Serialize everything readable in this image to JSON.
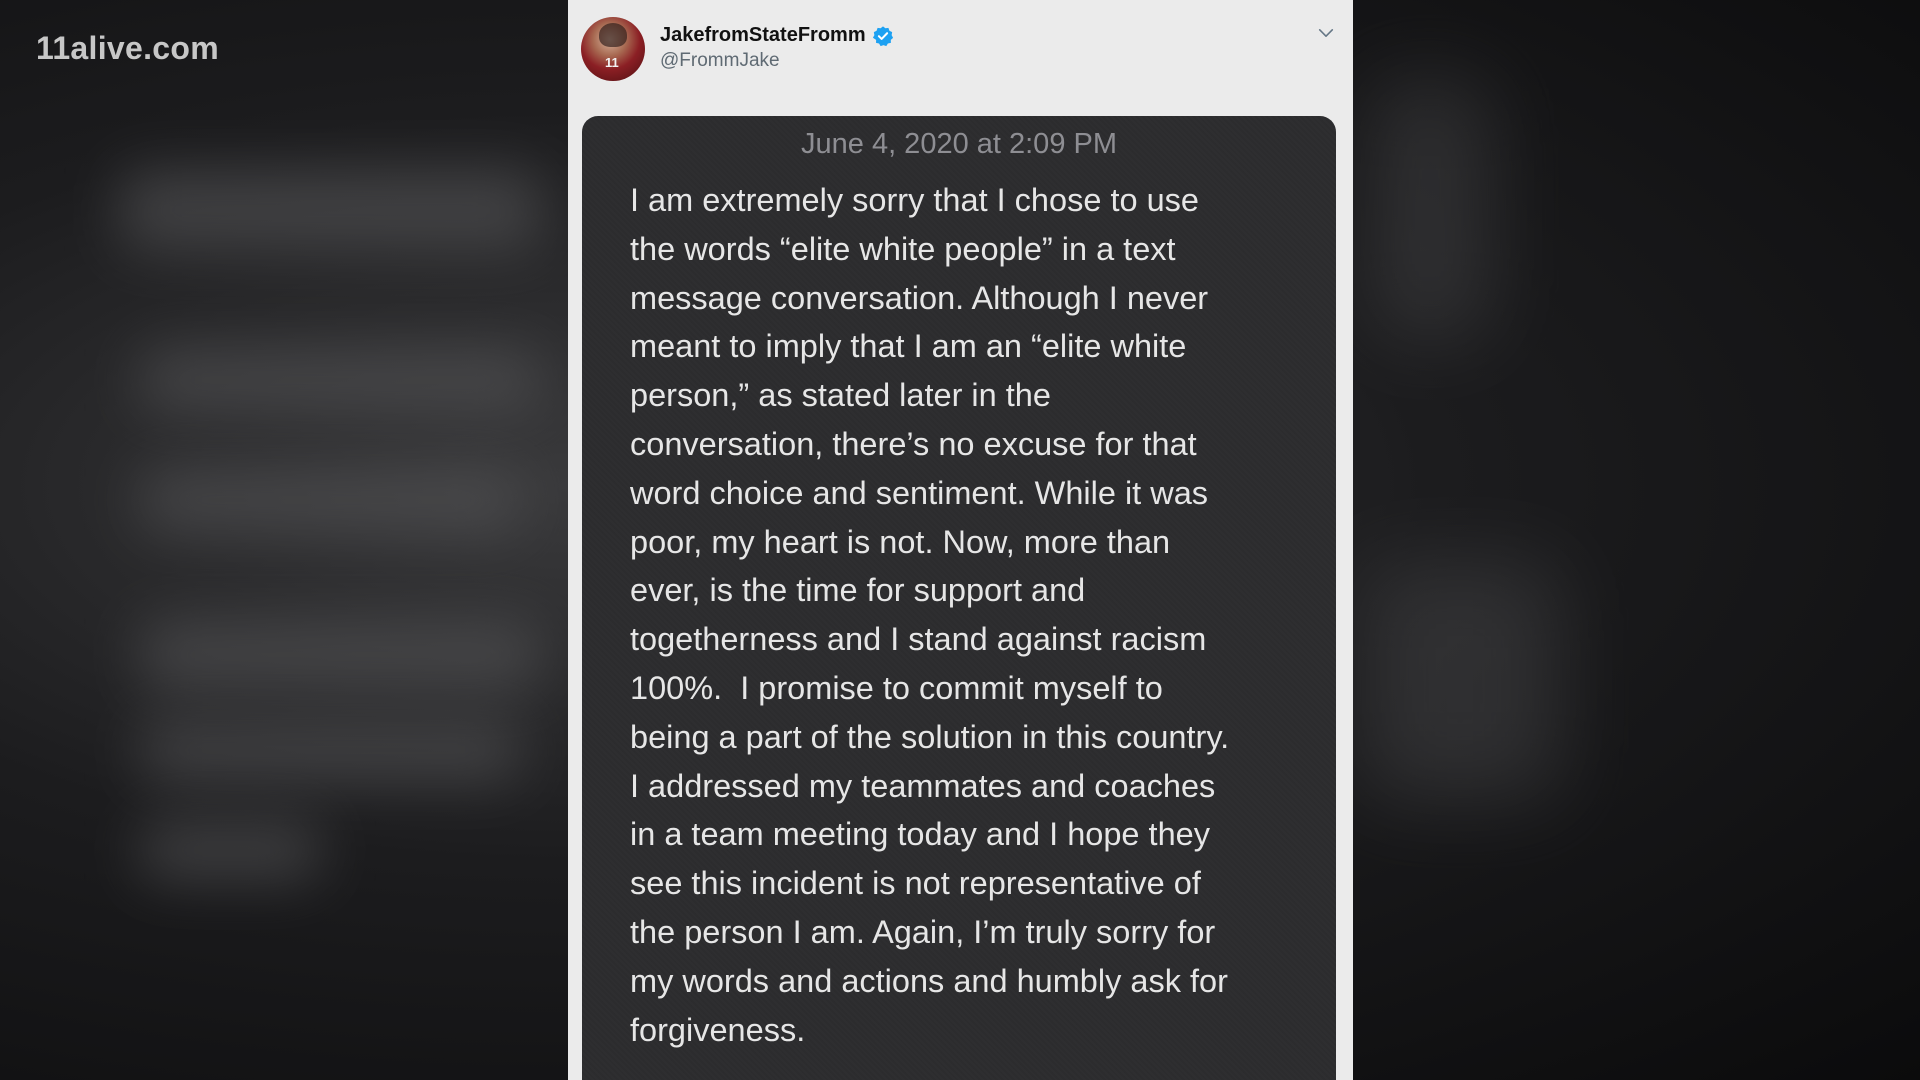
{
  "watermark": "11alive.com",
  "tweet": {
    "display_name": "JakefromStateFromm",
    "handle": "@FrommJake",
    "avatar_jersey_number": "11",
    "verified": true,
    "icons": {
      "verified": "verified-badge-icon",
      "menu": "chevron-down-icon"
    },
    "accent_color": "#1da1f2"
  },
  "screenshot": {
    "timestamp": "June 4, 2020 at 2:09 PM",
    "lines": [
      "I am extremely sorry that I chose to use",
      "the words “elite white people” in a text",
      "message conversation. Although I never",
      "meant to imply that I am an “elite white",
      "person,” as stated later in the",
      "conversation, there’s no excuse for that",
      "word choice and sentiment. While it was",
      "poor, my heart is not. Now, more than",
      "ever, is the time for support and",
      "togetherness and I stand against racism",
      "100%.  I promise to commit myself to",
      "being a part of the solution in this country.",
      "I addressed my teammates and coaches",
      "in a team meeting today and I hope they",
      "see this incident is not representative of",
      "the person I am. Again, I’m truly sorry for",
      "my words and actions and humbly ask for",
      "forgiveness."
    ]
  }
}
